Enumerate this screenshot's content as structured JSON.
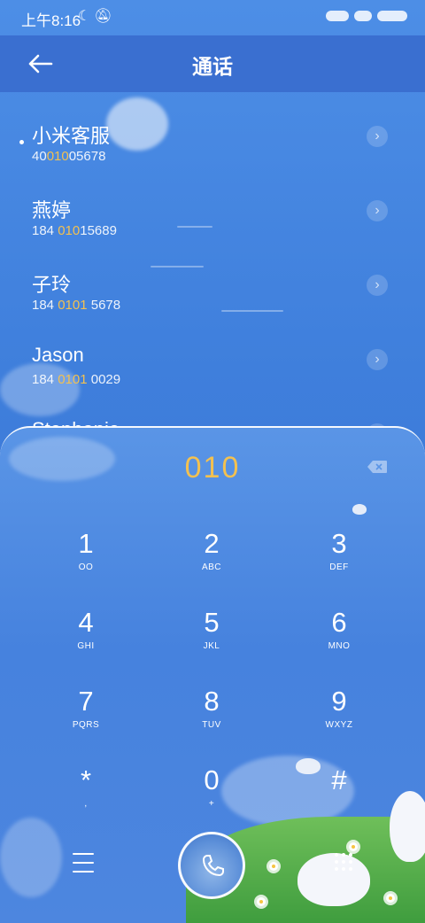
{
  "status_bar": {
    "time": "上午8:16",
    "icons": [
      "moon-icon",
      "mute-icon"
    ]
  },
  "header": {
    "title": "通话",
    "back_icon": "arrow-left-icon"
  },
  "contacts": [
    {
      "name": "小米客服",
      "number_pre": "40",
      "number_hl": "010",
      "number_post": "05678"
    },
    {
      "name": "燕婷",
      "number_pre": "184 ",
      "number_hl": "010",
      "number_post": "15689"
    },
    {
      "name": "子玲",
      "number_pre": "184 ",
      "number_hl": "0101",
      "number_post": " 5678"
    },
    {
      "name": "Jason",
      "number_pre": "184 ",
      "number_hl": "0101",
      "number_post": " 0029"
    },
    {
      "name": "Stephanie",
      "number_pre": "",
      "number_hl": "",
      "number_post": ""
    }
  ],
  "dialer": {
    "input": "010",
    "keys": [
      {
        "digit": "1",
        "letters": "OO"
      },
      {
        "digit": "2",
        "letters": "ABC"
      },
      {
        "digit": "3",
        "letters": "DEF"
      },
      {
        "digit": "4",
        "letters": "GHI"
      },
      {
        "digit": "5",
        "letters": "JKL"
      },
      {
        "digit": "6",
        "letters": "MNO"
      },
      {
        "digit": "7",
        "letters": "PQRS"
      },
      {
        "digit": "8",
        "letters": "TUV"
      },
      {
        "digit": "9",
        "letters": "WXYZ"
      },
      {
        "digit": "*",
        "letters": ","
      },
      {
        "digit": "0",
        "letters": "+"
      },
      {
        "digit": "#",
        "letters": ""
      }
    ]
  },
  "colors": {
    "highlight": "#f3c150",
    "header_bg": "#3a6fd0"
  }
}
